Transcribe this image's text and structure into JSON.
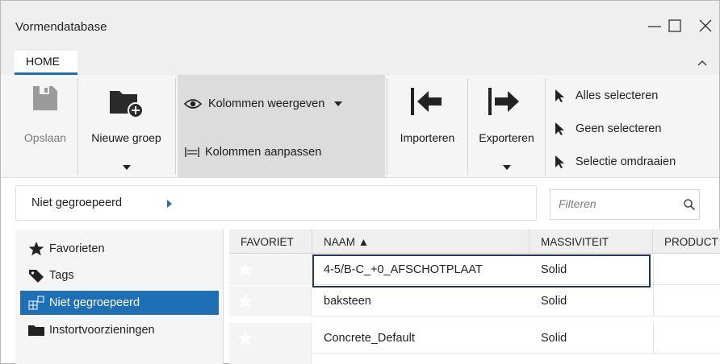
{
  "window": {
    "title": "Vormendatabase",
    "controls": {
      "minimize": "—",
      "maximize": "☐",
      "close": "✕"
    }
  },
  "tabs": [
    {
      "label": "HOME",
      "active": true
    }
  ],
  "ribbon": {
    "save_label": "Opslaan",
    "new_group_label": "Nieuwe groep",
    "show_columns_label": "Kolommen weergeven",
    "adjust_columns_label": "Kolommen aanpassen",
    "import_label": "Importeren",
    "export_label": "Exporteren",
    "select_all_label": "Alles selecteren",
    "select_none_label": "Geen selecteren",
    "invert_selection_label": "Selectie omdraaien"
  },
  "breadcrumb": {
    "current": "Niet gegroepeerd"
  },
  "filter": {
    "placeholder": "Filteren",
    "value": ""
  },
  "tree": {
    "items": [
      {
        "label": "Favorieten",
        "icon": "star-icon",
        "selected": false
      },
      {
        "label": "Tags",
        "icon": "tag-icon",
        "selected": false
      },
      {
        "label": "Niet gegroepeerd",
        "icon": "ungrouped-icon",
        "selected": true
      },
      {
        "label": "Instortvoorzieningen",
        "icon": "folder-icon",
        "selected": false
      }
    ]
  },
  "table": {
    "columns": [
      "FAVORIET",
      "NAAM ▲",
      "MASSIVITEIT",
      "PRODUCT"
    ],
    "rows": [
      {
        "favorite": false,
        "name": "4-5/B-C_+0_AFSCHOTPLAAT",
        "solidity": "Solid",
        "product": ""
      },
      {
        "favorite": false,
        "name": "baksteen",
        "solidity": "Solid",
        "product": ""
      },
      {
        "favorite": false,
        "name": "Concrete_Default",
        "solidity": "Solid",
        "product": ""
      }
    ]
  },
  "colors": {
    "accent": "#1e6fb5",
    "selection_outline": "#1d3a5c",
    "ribbon_pressed": "#dcdcdc"
  }
}
